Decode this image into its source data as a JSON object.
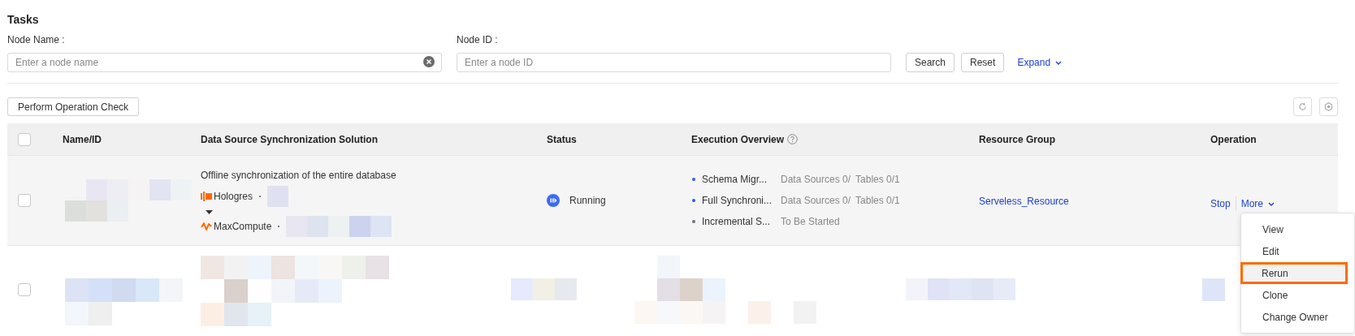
{
  "title": "Tasks",
  "filters": [
    {
      "label": "Node Name :",
      "placeholder": "Enter a node name",
      "clearable": true
    },
    {
      "label": "Node ID :",
      "placeholder": "Enter a node ID",
      "clearable": false
    }
  ],
  "filter_buttons": [
    "Search",
    "Reset"
  ],
  "expand_link": "Expand",
  "toolbar_button": "Perform Operation Check",
  "table": {
    "columns": [
      "Name/ID",
      "Data Source Synchronization Solution",
      "Status",
      "Execution Overview",
      "Resource Group",
      "Operation"
    ],
    "header_checked": false,
    "rows": [
      {
        "checked": false,
        "kind": "task",
        "solution": {
          "title": "Offline synchronization of the entire database",
          "source": "Hologres",
          "target": "MaxCompute"
        },
        "status": "Running",
        "overview": [
          {
            "step": "Schema Migr...",
            "color": "#2e5bea",
            "details": [
              "Data Sources 0/",
              "Tables 0/1"
            ]
          },
          {
            "step": "Full Synchroni...",
            "color": "#2e5bea",
            "details": [
              "Data Sources 0/",
              "Tables 0/1"
            ]
          },
          {
            "step": "Incremental S...",
            "color": "#6b7280",
            "details": [
              "To Be Started"
            ]
          }
        ],
        "resource_group": "Serveless_Resource",
        "operations": [
          "Stop",
          "More"
        ]
      },
      {
        "checked": false,
        "kind": "blurred"
      }
    ]
  },
  "menu": [
    {
      "label": "View",
      "highlighted": false
    },
    {
      "label": "Edit",
      "highlighted": false
    },
    {
      "label": "Rerun",
      "highlighted": true
    },
    {
      "label": "Clone",
      "highlighted": false
    },
    {
      "label": "Change Owner",
      "highlighted": false
    }
  ]
}
